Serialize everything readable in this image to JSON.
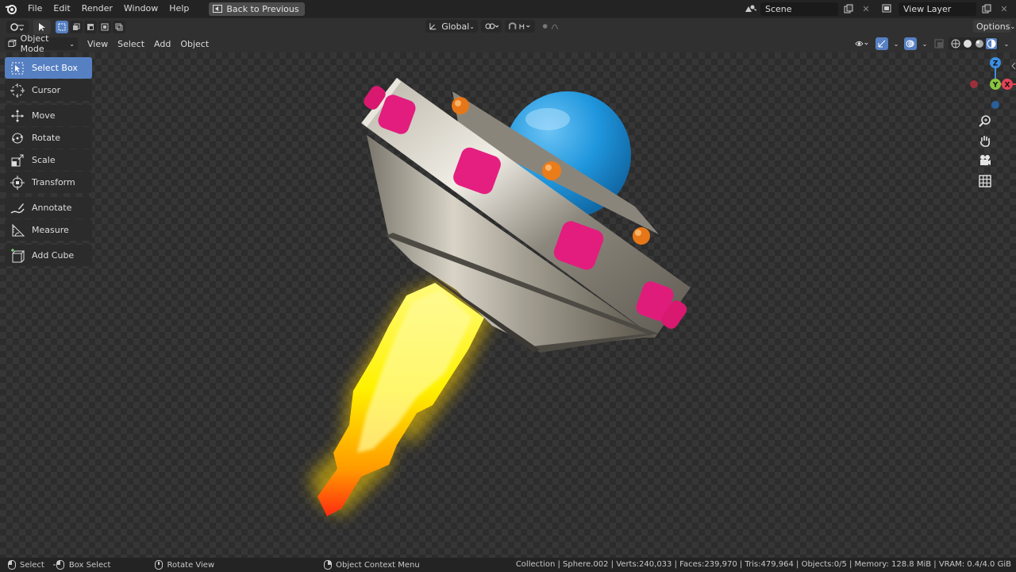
{
  "menubar": {
    "items": [
      "File",
      "Edit",
      "Render",
      "Window",
      "Help"
    ],
    "back_button": "Back to Previous",
    "scene_name": "Scene",
    "view_layer": "View Layer"
  },
  "header": {
    "transform_orientation": "Global",
    "options_label": "Options"
  },
  "viewport_header": {
    "mode": "Object Mode",
    "menus": [
      "View",
      "Select",
      "Add",
      "Object"
    ]
  },
  "tools": [
    {
      "label": "Select Box",
      "icon": "select-box-icon",
      "active": true
    },
    {
      "label": "Cursor",
      "icon": "cursor-icon"
    },
    {
      "label": "Move",
      "icon": "move-icon"
    },
    {
      "label": "Rotate",
      "icon": "rotate-icon"
    },
    {
      "label": "Scale",
      "icon": "scale-icon"
    },
    {
      "label": "Transform",
      "icon": "transform-icon"
    },
    {
      "label": "Annotate",
      "icon": "annotate-icon"
    },
    {
      "label": "Measure",
      "icon": "measure-icon"
    },
    {
      "label": "Add Cube",
      "icon": "add-cube-icon"
    }
  ],
  "gizmo": {
    "x": "X",
    "y": "Y",
    "z": "Z"
  },
  "statusbar": {
    "select": "Select",
    "box_select": "Box Select",
    "rotate_view": "Rotate View",
    "context_menu": "Object Context Menu",
    "stats": "Collection | Sphere.002 | Verts:240,033 | Faces:239,970 | Tris:479,964 | Objects:0/5 | Memory: 128.8 MiB | VRAM: 0.4/4.0 GiB"
  },
  "colors": {
    "accent": "#5680c2",
    "axis_x": "#e34356",
    "axis_y": "#8bc43f",
    "axis_z": "#3b8fe4",
    "dome": "#2a9be0",
    "studs": "#e0207a",
    "lights": "#e87a1c",
    "flame": "#fff200"
  }
}
